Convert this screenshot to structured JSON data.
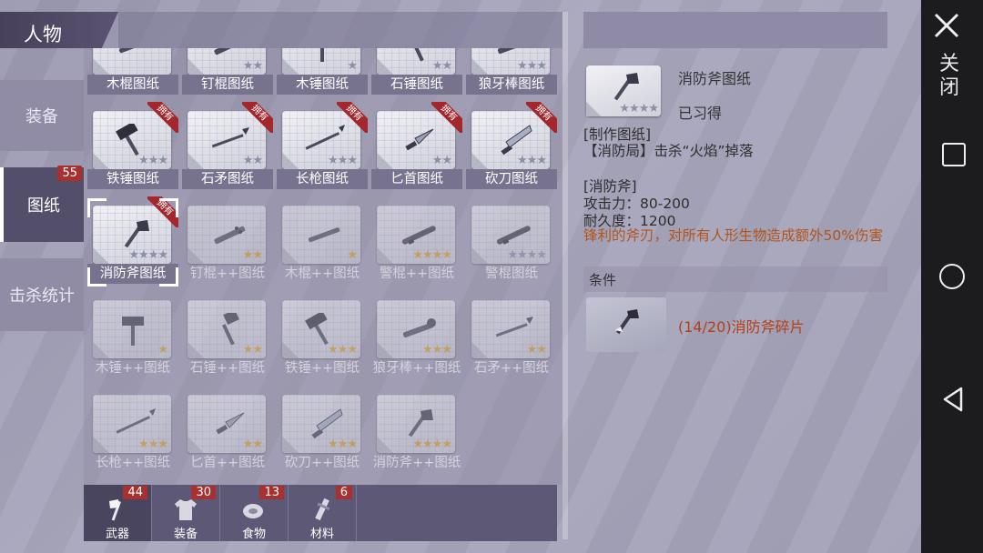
{
  "header": {
    "title": "人物"
  },
  "nav": {
    "tabs": [
      {
        "label": "装备"
      },
      {
        "label": "图纸",
        "badge": "55"
      },
      {
        "label": "击杀统计"
      }
    ]
  },
  "owned_label": "拥有",
  "grid": {
    "items": [
      {
        "name": "木棍图纸",
        "stars": 0,
        "max": 0,
        "owned": false,
        "dim": false,
        "icon": "stick-icon"
      },
      {
        "name": "钉棍图纸",
        "stars": 0,
        "max": 2,
        "owned": false,
        "dim": false,
        "icon": "nail-club-icon"
      },
      {
        "name": "木锤图纸",
        "stars": 0,
        "max": 1,
        "owned": false,
        "dim": false,
        "icon": "wood-hammer-icon"
      },
      {
        "name": "石锤图纸",
        "stars": 0,
        "max": 2,
        "owned": false,
        "dim": false,
        "icon": "stone-hammer-icon"
      },
      {
        "name": "狼牙棒图纸",
        "stars": 0,
        "max": 3,
        "owned": false,
        "dim": false,
        "icon": "mace-icon"
      },
      {
        "name": "铁锤图纸",
        "stars": 0,
        "max": 3,
        "owned": true,
        "dim": false,
        "icon": "iron-hammer-icon"
      },
      {
        "name": "石矛图纸",
        "stars": 0,
        "max": 2,
        "owned": true,
        "dim": false,
        "icon": "stone-spear-icon"
      },
      {
        "name": "长枪图纸",
        "stars": 0,
        "max": 3,
        "owned": true,
        "dim": false,
        "icon": "long-spear-icon"
      },
      {
        "name": "匕首图纸",
        "stars": 0,
        "max": 2,
        "owned": true,
        "dim": false,
        "icon": "dagger-icon"
      },
      {
        "name": "砍刀图纸",
        "stars": 0,
        "max": 3,
        "owned": true,
        "dim": false,
        "icon": "machete-icon"
      },
      {
        "name": "消防斧图纸",
        "stars": 0,
        "max": 4,
        "owned": true,
        "dim": false,
        "selected": true,
        "icon": "fire-axe-icon"
      },
      {
        "name": "钉棍++图纸",
        "stars": 2,
        "max": 2,
        "owned": false,
        "dim": true,
        "icon": "nail-club-icon"
      },
      {
        "name": "木棍++图纸",
        "stars": 1,
        "max": 1,
        "owned": false,
        "dim": true,
        "icon": "stick-icon"
      },
      {
        "name": "警棍++图纸",
        "stars": 4,
        "max": 4,
        "owned": false,
        "dim": true,
        "icon": "baton-icon"
      },
      {
        "name": "警棍图纸",
        "stars": 0,
        "max": 4,
        "owned": false,
        "dim": true,
        "icon": "baton-icon"
      },
      {
        "name": "木锤++图纸",
        "stars": 1,
        "max": 1,
        "owned": false,
        "dim": true,
        "icon": "wood-hammer-icon"
      },
      {
        "name": "石锤++图纸",
        "stars": 2,
        "max": 2,
        "owned": false,
        "dim": true,
        "icon": "stone-hammer-icon"
      },
      {
        "name": "铁锤++图纸",
        "stars": 3,
        "max": 3,
        "owned": false,
        "dim": true,
        "icon": "iron-hammer-icon"
      },
      {
        "name": "狼牙棒++图纸",
        "stars": 3,
        "max": 3,
        "owned": false,
        "dim": true,
        "icon": "mace-icon"
      },
      {
        "name": "石矛++图纸",
        "stars": 2,
        "max": 2,
        "owned": false,
        "dim": true,
        "icon": "stone-spear-icon"
      },
      {
        "name": "长枪++图纸",
        "stars": 3,
        "max": 3,
        "owned": false,
        "dim": true,
        "icon": "long-spear-icon"
      },
      {
        "name": "匕首++图纸",
        "stars": 2,
        "max": 2,
        "owned": false,
        "dim": true,
        "icon": "dagger-icon"
      },
      {
        "name": "砍刀++图纸",
        "stars": 3,
        "max": 3,
        "owned": false,
        "dim": true,
        "icon": "machete-icon"
      },
      {
        "name": "消防斧++图纸",
        "stars": 4,
        "max": 4,
        "owned": false,
        "dim": true,
        "icon": "fire-axe-icon"
      }
    ]
  },
  "bottom_tabs": [
    {
      "label": "武器",
      "badge": "44",
      "icon": "axe-icon"
    },
    {
      "label": "装备",
      "badge": "30",
      "icon": "shirt-icon"
    },
    {
      "label": "食物",
      "badge": "13",
      "icon": "meat-icon"
    },
    {
      "label": "材料",
      "badge": "6",
      "icon": "material-icon"
    }
  ],
  "detail": {
    "title": "消防斧图纸",
    "stars": 0,
    "max": 4,
    "status": "已习得",
    "craft_heading": "[制作图纸]",
    "craft_source": "【消防局】击杀“火焰”掉落",
    "item_heading": "[消防斧]",
    "attack": "攻击力：80-200",
    "durability": "耐久度：1200",
    "effect": "锋利的斧刃，对所有人形生物造成额外50%伤害",
    "condition_label": "条件",
    "fragment_text": "(14/20)消防斧碎片",
    "colors": {
      "heading": "#2a4d8f",
      "effect": "#b3541a",
      "fragment": "#b3401a"
    }
  },
  "android": {
    "close_label": "关闭"
  }
}
